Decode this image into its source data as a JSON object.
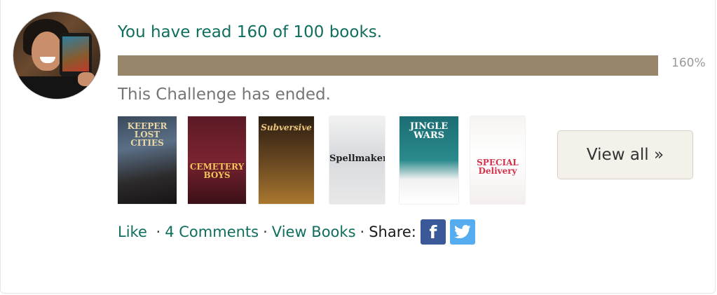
{
  "challenge": {
    "progress_text": "You have read 160 of 100 books.",
    "books_read": 160,
    "books_goal": 100,
    "percent_label": "160%",
    "progress_fraction": 1.0,
    "status_text": "This Challenge has ended."
  },
  "books": [
    {
      "cover_text": "KEEPER LOST CITIES"
    },
    {
      "cover_text": "CEMETERY BOYS"
    },
    {
      "cover_text": "Subversive"
    },
    {
      "cover_text": "Spellmaker"
    },
    {
      "cover_text": "JINGLE WARS"
    },
    {
      "cover_text": "SPECIAL Delivery"
    }
  ],
  "view_all_label": "View all »",
  "actions": {
    "like": "Like",
    "comments": "4 Comments",
    "view_books": "View Books",
    "share_label": "Share:",
    "facebook_icon": "facebook-icon",
    "twitter_icon": "twitter-icon"
  },
  "colors": {
    "link_green": "#0f6e5d",
    "progress_fill": "#968568",
    "facebook_blue": "#3b5998",
    "twitter_blue": "#55acee"
  }
}
